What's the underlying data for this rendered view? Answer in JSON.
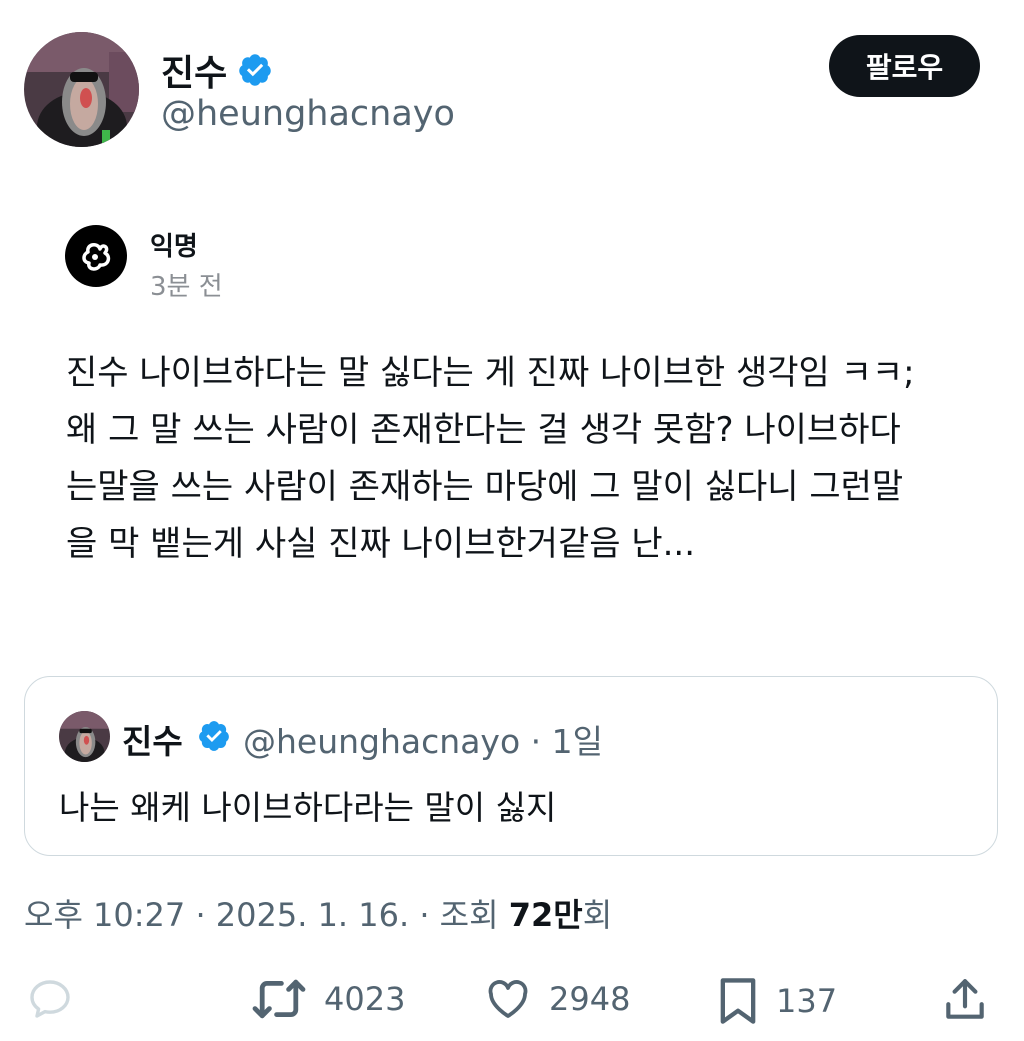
{
  "author": {
    "name": "진수",
    "handle": "@heunghacnayo",
    "follow_label": "팔로우"
  },
  "embedded": {
    "name": "익명",
    "time": "3분 전",
    "lines": [
      "진수 나이브하다는 말 싫다는 게 진짜 나이브한 생각임 ㅋㅋ;",
      "왜 그 말 쓰는 사람이 존재한다는 걸 생각 못함? 나이브하다",
      "는말을 쓰는 사람이 존재하는 마당에 그 말이 싫다니 그런말",
      "을 막 뱉는게 사실 진짜 나이브한거같음 난..."
    ]
  },
  "quote": {
    "name": "진수",
    "handle_time": "@heunghacnayo · 1일",
    "text": "나는 왜케 나이브하다라는 말이 싫지"
  },
  "meta": {
    "prefix": "오후 10:27 · 2025. 1. 16. · 조회 ",
    "views": "72만",
    "suffix": "회"
  },
  "actions": {
    "retweets": "4023",
    "likes": "2948",
    "bookmarks": "137"
  },
  "colors": {
    "verified": "#1d9bf0",
    "text": "#0f1419",
    "secondary": "#536471",
    "border": "#cfd9de"
  }
}
